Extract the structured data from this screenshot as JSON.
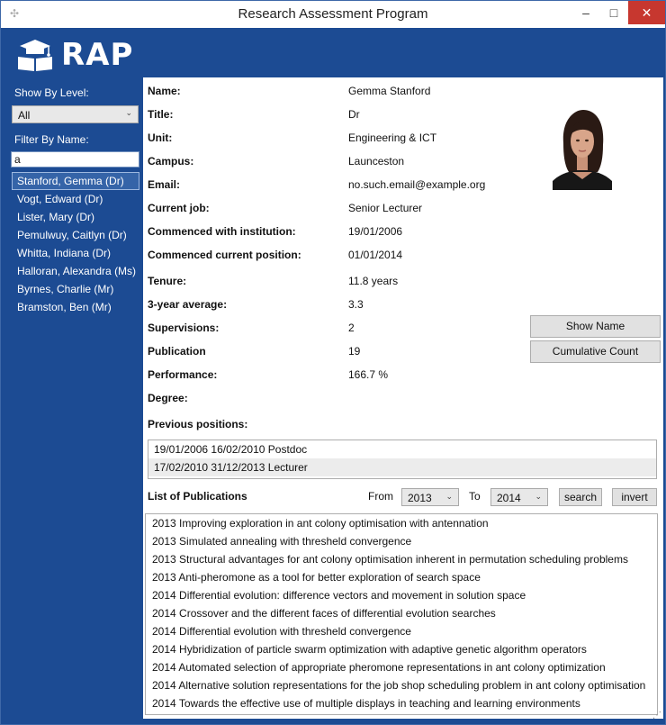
{
  "window": {
    "title": "Research Assessment Program",
    "controls": {
      "minimize": "–",
      "maximize": "□",
      "close": "✕"
    }
  },
  "logo": {
    "text": "RAP",
    "icon": "graduation-cap-book-icon"
  },
  "sidebar": {
    "show_by_level_label": "Show By Level:",
    "level_selected": "All",
    "filter_by_name_label": "Filter By Name:",
    "filter_value": "a",
    "researchers": [
      "Stanford, Gemma (Dr)",
      "Vogt, Edward (Dr)",
      "Lister, Mary (Dr)",
      "Pemulwuy, Caitlyn (Dr)",
      "Whitta, Indiana (Dr)",
      "Halloran, Alexandra (Ms)",
      "Byrnes, Charlie (Mr)",
      "Bramston, Ben (Mr)"
    ]
  },
  "details": {
    "fields": [
      {
        "label": "Name:",
        "value": "Gemma Stanford"
      },
      {
        "label": "Title:",
        "value": "Dr"
      },
      {
        "label": "Unit:",
        "value": "Engineering & ICT"
      },
      {
        "label": "Campus:",
        "value": "Launceston"
      },
      {
        "label": "Email:",
        "value": "no.such.email@example.org"
      },
      {
        "label": "Current job:",
        "value": "Senior Lecturer"
      },
      {
        "label": "Commenced with institution:",
        "value": "19/01/2006"
      },
      {
        "label": "Commenced current position:",
        "value": "01/01/2014"
      },
      {
        "label": "Tenure:",
        "value": "11.8 years"
      },
      {
        "label": "3-year average:",
        "value": "3.3"
      },
      {
        "label": "Supervisions:",
        "value": "2"
      },
      {
        "label": "Publication",
        "value": "19"
      },
      {
        "label": "Performance:",
        "value": "166.7 %"
      },
      {
        "label": "Degree:",
        "value": ""
      }
    ],
    "show_name_button": "Show Name",
    "cumulative_count_button": "Cumulative Count",
    "previous_positions_label": "Previous positions:",
    "previous_positions": [
      "19/01/2006 16/02/2010 Postdoc",
      "17/02/2010 31/12/2013 Lecturer"
    ]
  },
  "publications": {
    "label": "List of Publications",
    "from_label": "From",
    "from_year": "2013",
    "to_label": "To",
    "to_year": "2014",
    "search_button": "search",
    "invert_button": "invert",
    "items": [
      "2013 Improving exploration in ant colony optimisation with antennation",
      "2013 Simulated annealing with thresheld convergence",
      "2013 Structural advantages for ant colony optimisation inherent in permutation scheduling problems",
      "2013 Anti-pheromone as a tool for better exploration of search space",
      "2014 Differential evolution: difference vectors and movement in solution space",
      "2014 Crossover and the different faces of differential evolution searches",
      "2014 Differential evolution with thresheld convergence",
      "2014 Hybridization of particle swarm optimization with adaptive genetic algorithm operators",
      "2014 Automated selection of appropriate pheromone representations in ant colony optimization",
      "2014 Alternative solution representations for the job shop scheduling problem in ant colony optimisation",
      "2014 Towards the effective use of multiple displays in teaching and learning environments"
    ]
  },
  "colors": {
    "window_blue": "#1c4b93",
    "close_red": "#c7372f",
    "selection_blue": "#3564a8"
  }
}
